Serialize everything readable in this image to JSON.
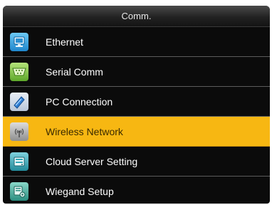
{
  "header": {
    "title": "Comm."
  },
  "menu": {
    "items": [
      {
        "label": "Ethernet",
        "icon": "ethernet-icon",
        "color": "#2aa0e0"
      },
      {
        "label": "Serial Comm",
        "icon": "serial-port-icon",
        "color": "#7cc63a"
      },
      {
        "label": "PC Connection",
        "icon": "pc-connection-icon",
        "color": "#3b86d6"
      },
      {
        "label": "Wireless Network",
        "icon": "wireless-antenna-icon",
        "color": "#9a9a9a",
        "selected": true
      },
      {
        "label": "Cloud Server Setting",
        "icon": "cloud-server-icon",
        "color": "#2fa8b8"
      },
      {
        "label": "Wiegand Setup",
        "icon": "wiegand-icon",
        "color": "#3aaa9a"
      }
    ]
  },
  "colors": {
    "selected_bg": "#f7b712",
    "list_bg": "#0b0b0b",
    "header_bg": "#222222"
  }
}
